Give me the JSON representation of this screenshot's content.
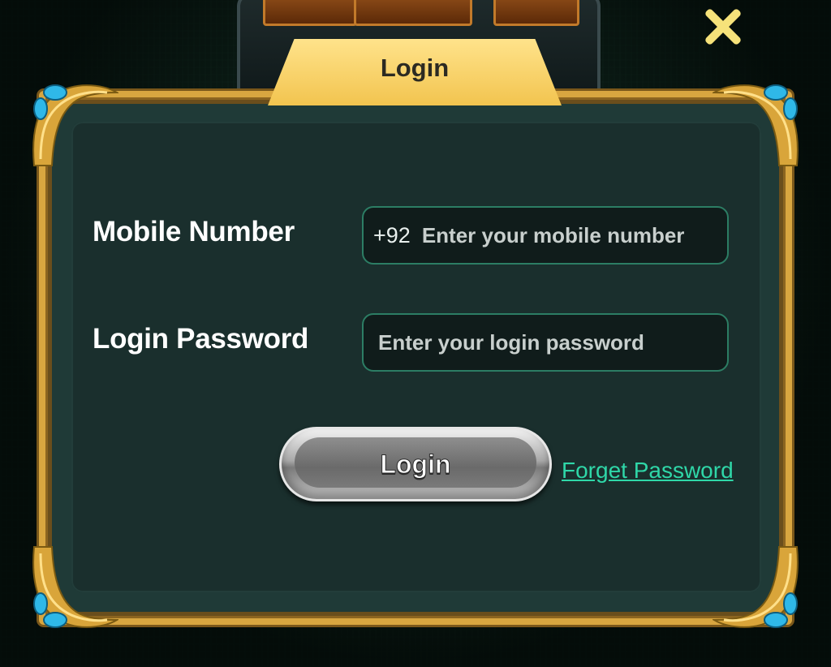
{
  "dialog": {
    "title": "Login",
    "close_icon": "close-icon"
  },
  "form": {
    "mobile_label": "Mobile Number",
    "mobile_prefix": "+92",
    "mobile_placeholder": "Enter your mobile number",
    "password_label": "Login Password",
    "password_placeholder": "Enter your login password"
  },
  "actions": {
    "login_label": "Login",
    "forget_label": "Forget Password"
  },
  "colors": {
    "accent_gold": "#f2c44f",
    "field_border": "#2c7d64",
    "link": "#2fd7a8"
  }
}
